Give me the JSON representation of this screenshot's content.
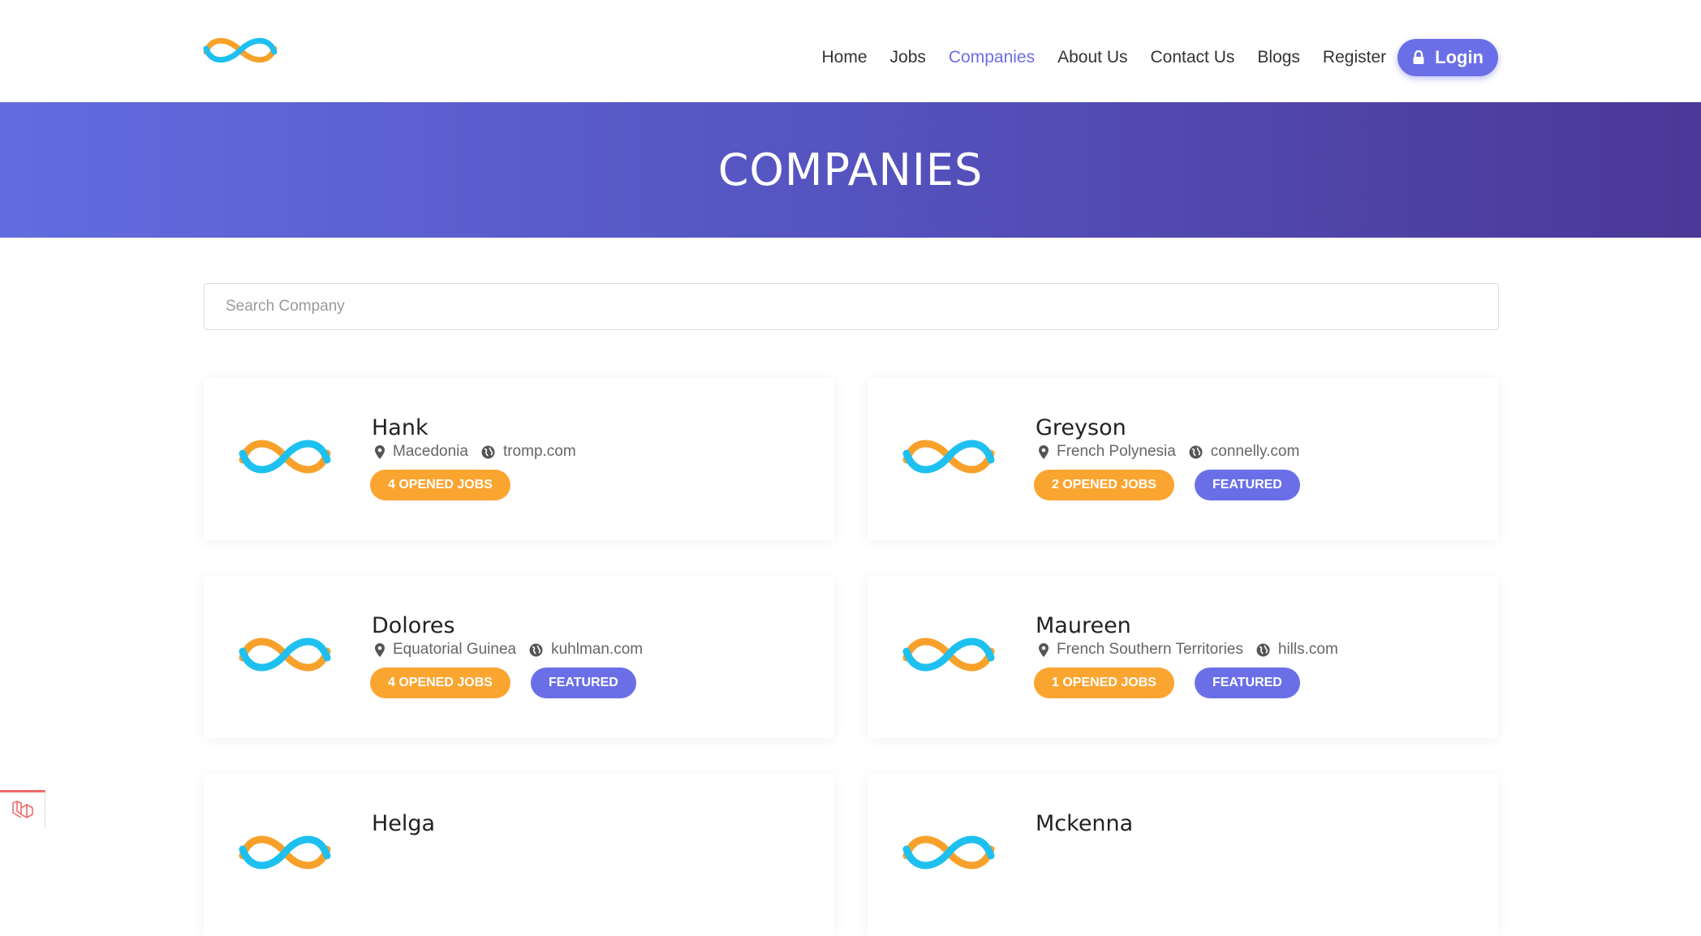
{
  "nav": {
    "items": [
      {
        "label": "Home",
        "active": false
      },
      {
        "label": "Jobs",
        "active": false
      },
      {
        "label": "Companies",
        "active": true
      },
      {
        "label": "About Us",
        "active": false
      },
      {
        "label": "Contact Us",
        "active": false
      },
      {
        "label": "Blogs",
        "active": false
      },
      {
        "label": "Register",
        "active": false
      }
    ],
    "login_label": "Login"
  },
  "banner": {
    "title": "COMPANIES"
  },
  "search": {
    "placeholder": "Search Company",
    "value": ""
  },
  "companies": [
    {
      "name": "Hank",
      "location": "Macedonia",
      "website": "tromp.com",
      "jobs_label": "4 OPENED JOBS",
      "featured": false
    },
    {
      "name": "Greyson",
      "location": "French Polynesia",
      "website": "connelly.com",
      "jobs_label": "2 OPENED JOBS",
      "featured": true
    },
    {
      "name": "Dolores",
      "location": "Equatorial Guinea",
      "website": "kuhlman.com",
      "jobs_label": "4 OPENED JOBS",
      "featured": true
    },
    {
      "name": "Maureen",
      "location": "French Southern Territories",
      "website": "hills.com",
      "jobs_label": "1 OPENED JOBS",
      "featured": true
    },
    {
      "name": "Helga",
      "location": "",
      "website": "",
      "jobs_label": "",
      "featured": false
    },
    {
      "name": "Mckenna",
      "location": "",
      "website": "",
      "jobs_label": "",
      "featured": false
    }
  ],
  "featured_label": "FEATURED",
  "colors": {
    "accent": "#6a6fe8",
    "jobs_badge": "#fba531",
    "banner_start": "#626ce0",
    "banner_end": "#4b3897",
    "logo_blue": "#1ec0f0",
    "logo_orange": "#f7a12b"
  },
  "icons": {
    "location": "map-marker-icon",
    "website": "globe-icon",
    "login": "lock-icon",
    "debug": "laravel-debugbar-icon"
  }
}
